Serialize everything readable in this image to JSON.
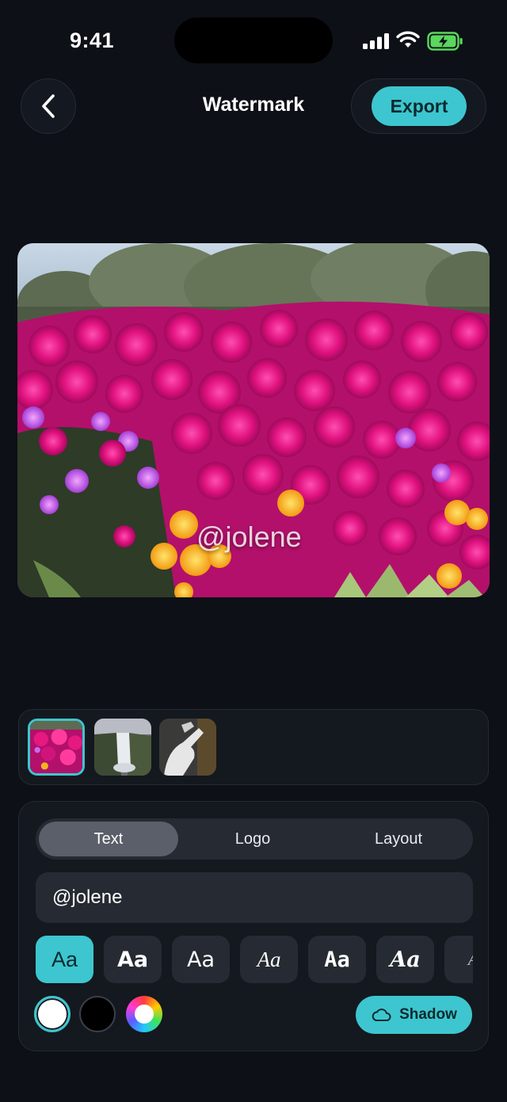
{
  "status_bar": {
    "time": "9:41"
  },
  "nav": {
    "title": "Watermark",
    "export_label": "Export"
  },
  "preview": {
    "watermark_text": "@jolene"
  },
  "thumbnails": [
    {
      "name": "flowers-thumbnail",
      "selected": true
    },
    {
      "name": "waterfall-thumbnail",
      "selected": false
    },
    {
      "name": "hand-sculpture-thumbnail",
      "selected": false
    }
  ],
  "tabs": [
    {
      "label": "Text",
      "active": true
    },
    {
      "label": "Logo",
      "active": false
    },
    {
      "label": "Layout",
      "active": false
    }
  ],
  "text_input": {
    "value": "@jolene"
  },
  "font_styles": [
    {
      "label": "Aa",
      "active": true
    },
    {
      "label": "Aa",
      "active": false
    },
    {
      "label": "Aa",
      "active": false
    },
    {
      "label": "Aa",
      "active": false
    },
    {
      "label": "Aa",
      "active": false
    },
    {
      "label": "Aa",
      "active": false
    },
    {
      "label": "A",
      "active": false
    }
  ],
  "colors": {
    "accent": "#3dc6cf",
    "swatch_white": "#ffffff",
    "swatch_black": "#000000"
  },
  "shadow_button": {
    "label": "Shadow"
  }
}
